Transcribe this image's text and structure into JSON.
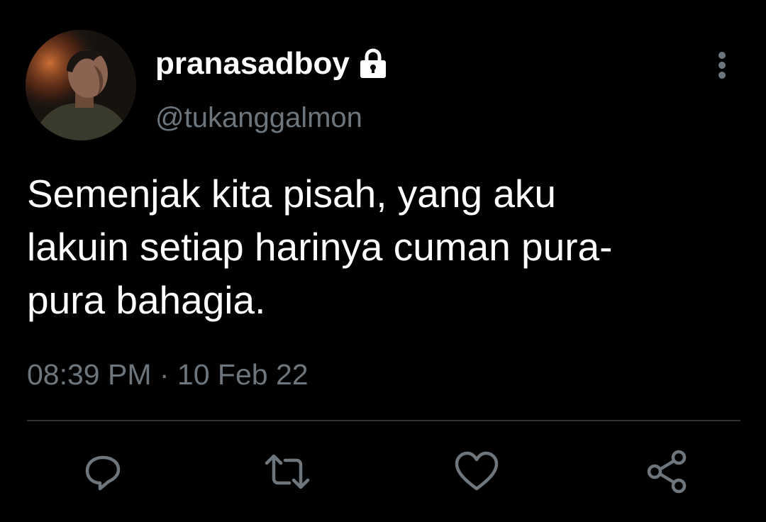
{
  "tweet": {
    "display_name": "pranasadboy",
    "handle": "@tukanggalmon",
    "text_lines": [
      "Semenjak kita pisah, yang aku",
      "lakuin setiap harinya cuman pura-",
      "pura bahagia."
    ],
    "timestamp": "08:39 PM · 10 Feb 22",
    "protected_icon": "lock-icon",
    "more_icon": "more-vertical-icon"
  },
  "actions": [
    {
      "name": "reply",
      "icon": "reply-icon"
    },
    {
      "name": "retweet",
      "icon": "retweet-icon"
    },
    {
      "name": "like",
      "icon": "heart-icon"
    },
    {
      "name": "share",
      "icon": "share-icon"
    }
  ],
  "colors": {
    "background": "#000000",
    "primary_text": "#ffffff",
    "secondary_text": "#6e767d",
    "divider": "#2f3336",
    "icon": "#6e767d"
  }
}
